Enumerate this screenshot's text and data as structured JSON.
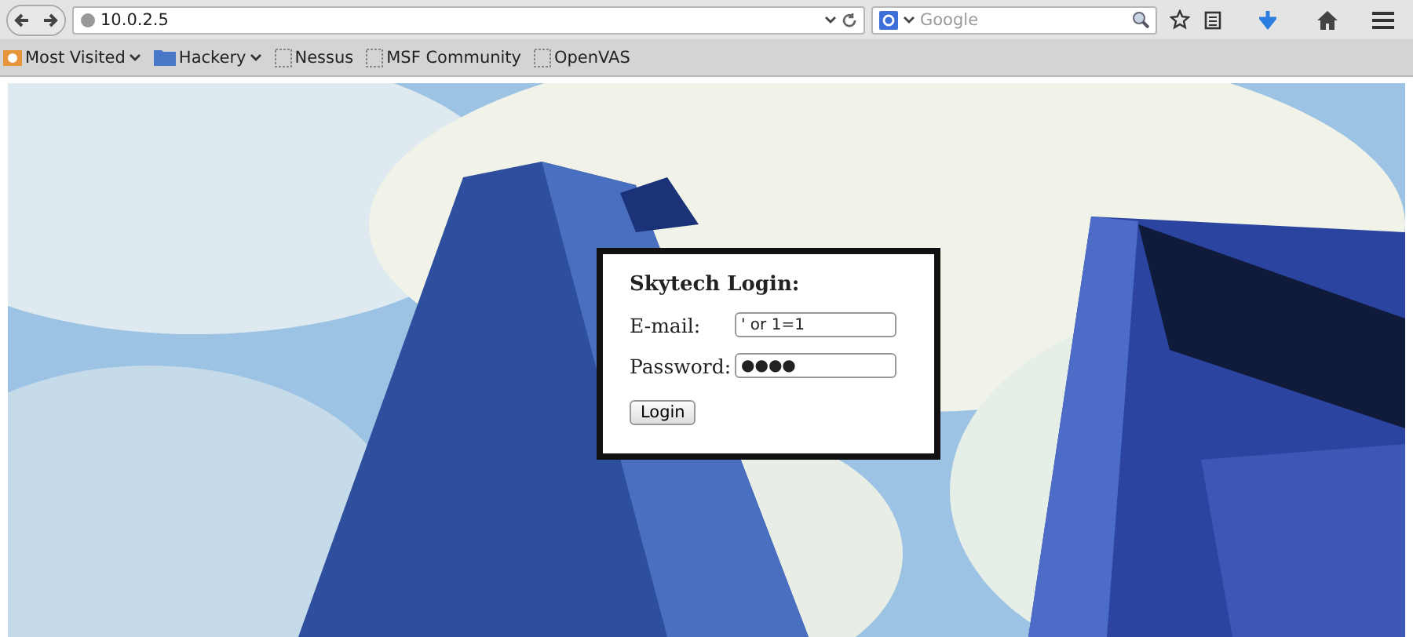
{
  "browser": {
    "url": "10.0.2.5",
    "search_placeholder": "Google",
    "bookmarks": [
      {
        "label": "Most Visited",
        "kind": "recent"
      },
      {
        "label": "Hackery",
        "kind": "folder"
      },
      {
        "label": "Nessus",
        "kind": "link"
      },
      {
        "label": "MSF Community",
        "kind": "link"
      },
      {
        "label": "OpenVAS",
        "kind": "link"
      }
    ]
  },
  "page": {
    "login": {
      "title": "Skytech Login:",
      "fields": [
        {
          "label": "E-mail:",
          "value": "' or 1=1"
        },
        {
          "label": "Password:",
          "value": "●●●●"
        }
      ],
      "button": "Login"
    }
  }
}
